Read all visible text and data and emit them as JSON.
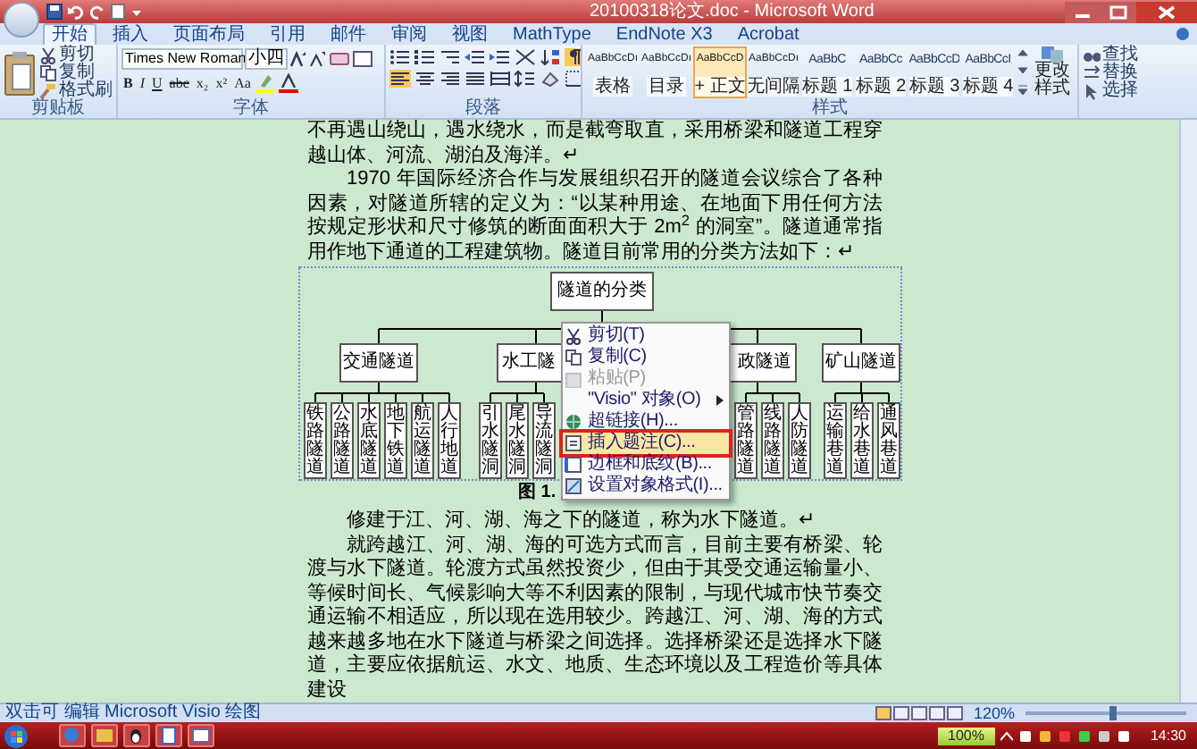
{
  "window": {
    "title": "20100318论文.doc - Microsoft Word"
  },
  "tabs": [
    {
      "label": "开始",
      "selected": true
    },
    {
      "label": "插入",
      "selected": false
    },
    {
      "label": "页面布局",
      "selected": false
    },
    {
      "label": "引用",
      "selected": false
    },
    {
      "label": "邮件",
      "selected": false
    },
    {
      "label": "审阅",
      "selected": false
    },
    {
      "label": "视图",
      "selected": false
    },
    {
      "label": "MathType",
      "selected": false
    },
    {
      "label": "EndNote X3",
      "selected": false
    },
    {
      "label": "Acrobat",
      "selected": false
    }
  ],
  "clipboard": {
    "items": [
      "剪切",
      "复制",
      "格式刷"
    ],
    "label": "剪贴板"
  },
  "font": {
    "name": "Times New Roman",
    "size": "小四",
    "buttons": [
      "B",
      "I",
      "U",
      "abc",
      "x₂",
      "x²",
      "Aa"
    ],
    "label": "字体"
  },
  "paragraph": {
    "label": "段落",
    "show_marks": true,
    "align": [
      {
        "selected": true
      },
      {
        "selected": false
      },
      {
        "selected": false
      },
      {
        "selected": false
      },
      {
        "selected": false
      }
    ]
  },
  "styles": {
    "label": "样式",
    "change": "更改样式",
    "items": [
      {
        "preview": "AaBbCcDı",
        "name": "表格",
        "selected": false
      },
      {
        "preview": "AaBbCcDı",
        "name": "目录",
        "selected": false
      },
      {
        "preview": "AaBbCcD",
        "name": "+ 正文",
        "selected": true
      },
      {
        "preview": "AaBbCcDı",
        "name": "无间隔",
        "selected": false
      },
      {
        "preview": "AaBbC",
        "name": "标题 1",
        "selected": false
      },
      {
        "preview": "AaBbCc",
        "name": "标题 2",
        "selected": false
      },
      {
        "preview": "AaBbCcD",
        "name": "标题 3",
        "selected": false
      },
      {
        "preview": "AaBbCcI",
        "name": "标题 4",
        "selected": false
      }
    ]
  },
  "editing": {
    "items": [
      "查找",
      "替换",
      "选择"
    ]
  },
  "document": {
    "before": [
      {
        "text": "不再遇山绕山，遇水绕水，而是截弯取直，采用桥梁和隧道工程穿越山体、河流、湖泊及海洋。↵",
        "indent": false
      },
      {
        "text": "1970 年国际经济合作与发展组织召开的隧道会议综合了各种因素，对隧道所辖的定义为：“以某种用途、在地面下用任何方法按规定形状和尺寸修筑的断面面积大于 2m$^{2}$ 的洞室”。隧道通常指用作地下通道的工程建筑物。隧道目前常用的分类方法如下：↵",
        "indent": true
      }
    ],
    "chart": {
      "root": "隧道的分类",
      "branches": [
        {
          "label": "交通隧道",
          "children": [
            "铁路隧道",
            "公路隧道",
            "水底隧道",
            "地下铁道",
            "航运隧道",
            "人行地道"
          ]
        },
        {
          "label": "水工隧",
          "children": [
            "引水隧洞",
            "尾水隧洞",
            "导流隧洞"
          ]
        },
        {
          "label": "政隧道",
          "children": [
            "管路隧道",
            "线路隧道",
            "人防隧道"
          ]
        },
        {
          "label": "矿山隧道",
          "children": [
            "运输巷道",
            "给水巷道",
            "通风巷道"
          ]
        }
      ]
    },
    "caption": "图 1.",
    "after": [
      {
        "text": "修建于江、河、湖、海之下的隧道，称为水下隧道。↵",
        "indent": true
      },
      {
        "text": "就跨越江、河、湖、海的可选方式而言，目前主要有桥梁、轮渡与水下隧道。轮渡方式虽然投资少，但由于其受交通运输量小、等候时间长、气候影响大等不利因素的限制，与现代城市快节奏交通运输不相适应，所以现在选用较少。跨越江、河、湖、海的方式越来越多地在水下隧道与桥梁之间选择。选择桥梁还是选择水下隧道，主要应依据航运、水文、地质、生态环境以及工程造价等具体建设",
        "indent": true
      }
    ]
  },
  "context_menu": {
    "items": [
      {
        "label": "剪切(T)",
        "kind": "item",
        "disabled": false,
        "selected": false,
        "callout": false
      },
      {
        "label": "复制(C)",
        "kind": "item",
        "disabled": false,
        "selected": false,
        "callout": false
      },
      {
        "label": "粘贴(P)",
        "kind": "item",
        "disabled": true,
        "selected": false,
        "callout": false
      },
      {
        "label": "\"Visio\" 对象(O)",
        "kind": "submenu",
        "disabled": false,
        "selected": false,
        "callout": false
      },
      {
        "label": "超链接(H)...",
        "kind": "item",
        "disabled": false,
        "selected": false,
        "callout": false
      },
      {
        "label": "插入题注(C)...",
        "kind": "item",
        "disabled": false,
        "selected": true,
        "callout": true
      },
      {
        "label": "边框和底纹(B)...",
        "kind": "item",
        "disabled": false,
        "selected": false,
        "callout": false
      },
      {
        "label": "设置对象格式(I)...",
        "kind": "item",
        "disabled": false,
        "selected": false,
        "callout": false
      }
    ]
  },
  "status_bar": {
    "text": "双击可 编辑 Microsoft Visio 绘图",
    "zoom": "120%",
    "level": 0.55
  },
  "taskbar": {
    "battery": "100%",
    "time": "14:30"
  }
}
